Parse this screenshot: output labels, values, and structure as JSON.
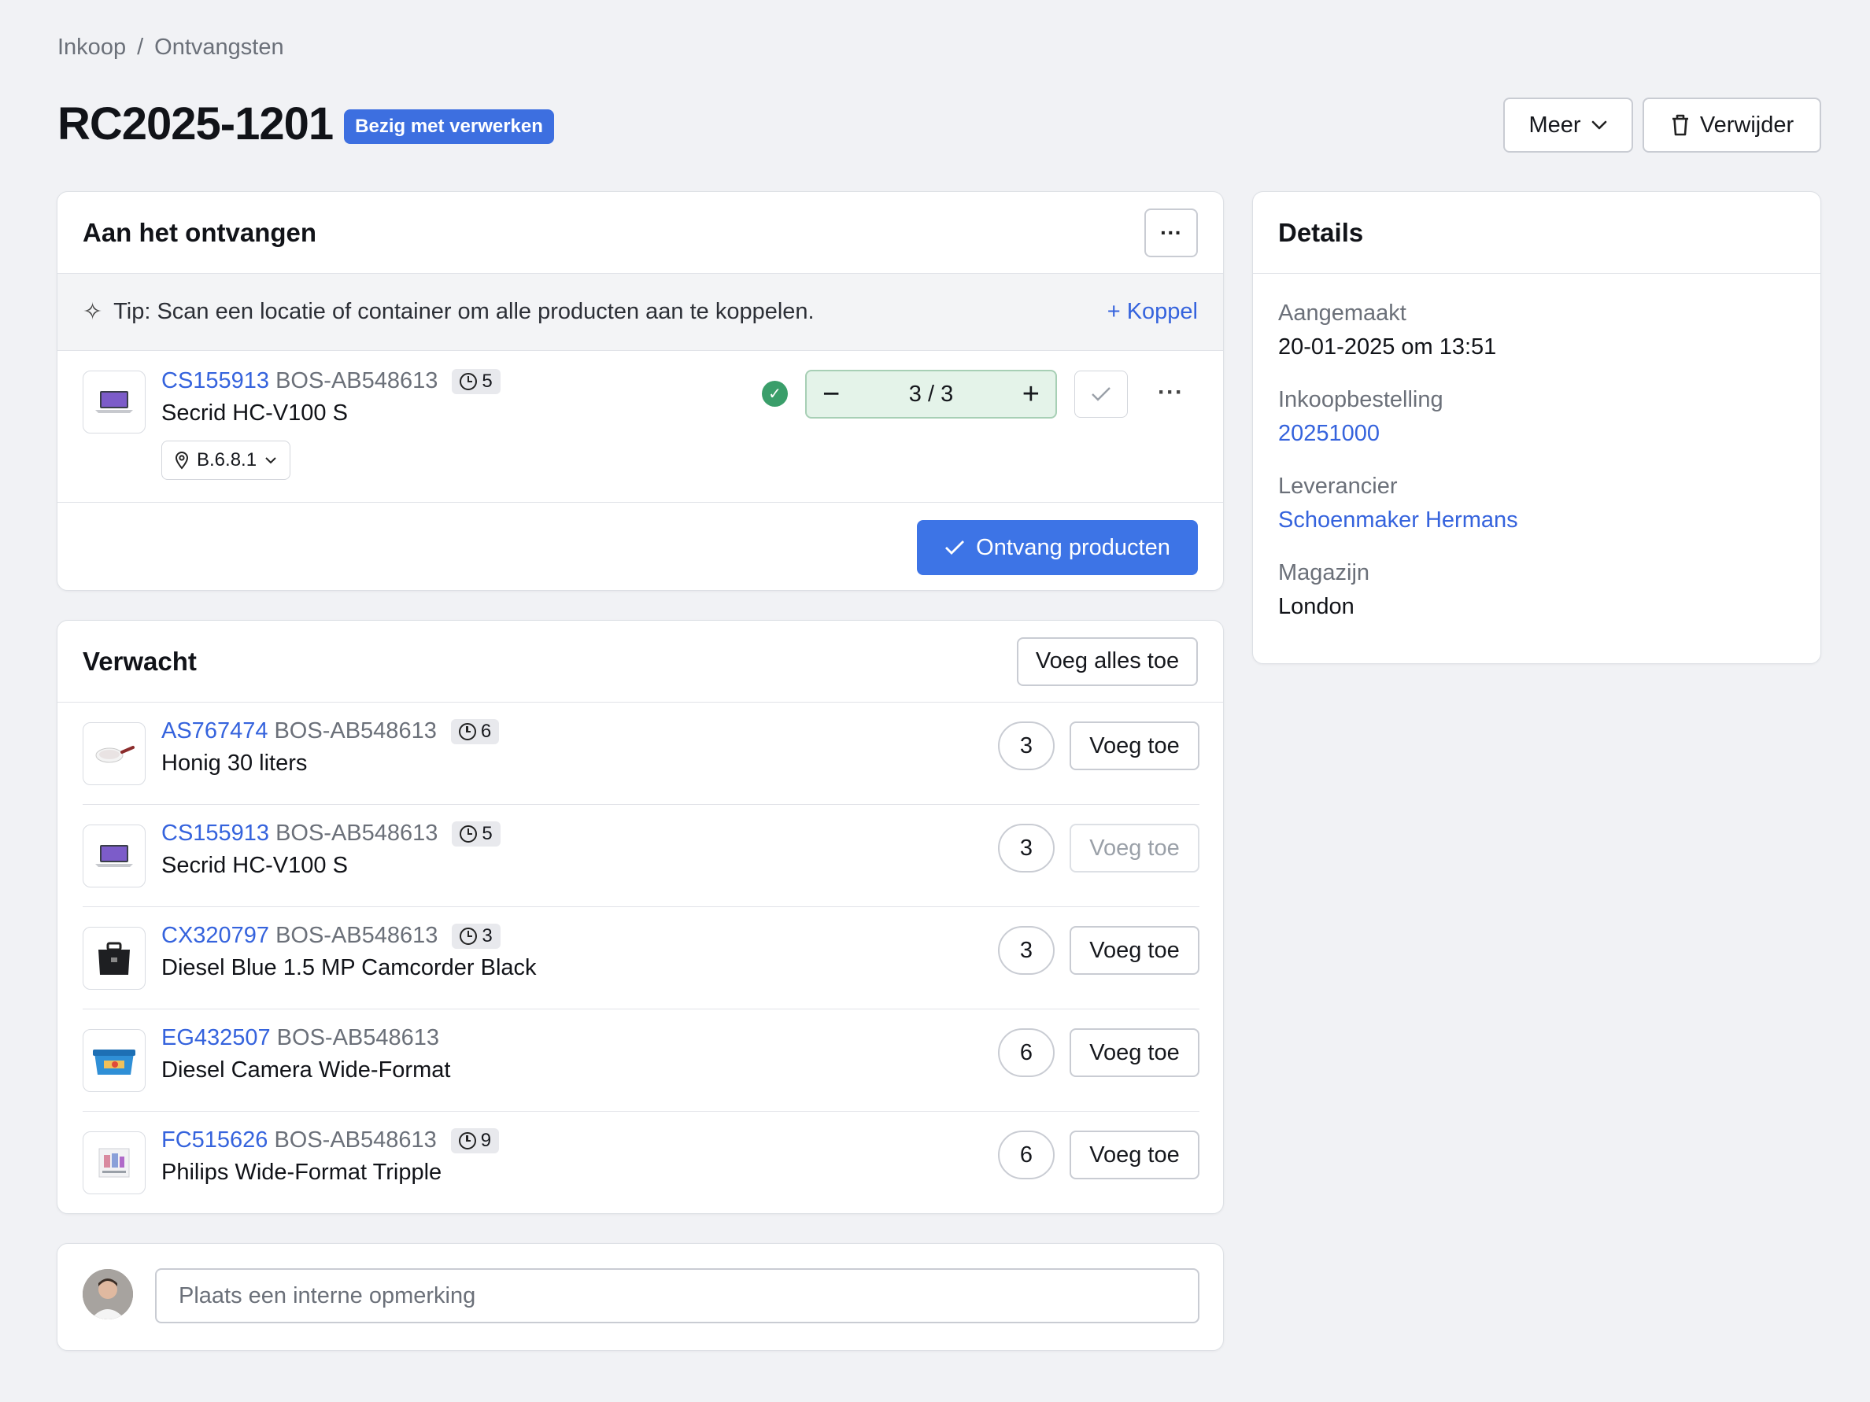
{
  "breadcrumb": {
    "parent": "Inkoop",
    "separator": "/",
    "current": "Ontvangsten"
  },
  "header": {
    "title": "RC2025-1201",
    "status": "Bezig met verwerken",
    "more_label": "Meer",
    "delete_label": "Verwijder"
  },
  "receiving": {
    "title": "Aan het ontvangen",
    "tip": "Tip: Scan een locatie of container om alle producten aan te koppelen.",
    "link_label": "+ Koppel",
    "item": {
      "sku": "CS155913",
      "ref": "BOS-AB548613",
      "badge": "5",
      "name": "Secrid HC-V100 S",
      "location": "B.6.8.1",
      "quantity": "3 / 3"
    },
    "submit_label": "Ontvang producten"
  },
  "expected": {
    "title": "Verwacht",
    "add_all_label": "Voeg alles toe",
    "add_label": "Voeg toe",
    "items": [
      {
        "sku": "AS767474",
        "ref": "BOS-AB548613",
        "badge": "6",
        "name": "Honig 30 liters",
        "qty": "3"
      },
      {
        "sku": "CS155913",
        "ref": "BOS-AB548613",
        "badge": "5",
        "name": "Secrid HC-V100 S",
        "qty": "3"
      },
      {
        "sku": "CX320797",
        "ref": "BOS-AB548613",
        "badge": "3",
        "name": "Diesel Blue 1.5 MP Camcorder Black",
        "qty": "3"
      },
      {
        "sku": "EG432507",
        "ref": "BOS-AB548613",
        "badge": "",
        "name": "Diesel Camera Wide-Format",
        "qty": "6"
      },
      {
        "sku": "FC515626",
        "ref": "BOS-AB548613",
        "badge": "9",
        "name": "Philips Wide-Format Tripple",
        "qty": "6"
      }
    ]
  },
  "comment": {
    "placeholder": "Plaats een interne opmerking"
  },
  "details": {
    "title": "Details",
    "created_label": "Aangemaakt",
    "created_value": "20-01-2025 om 13:51",
    "po_label": "Inkoopbestelling",
    "po_value": "20251000",
    "supplier_label": "Leverancier",
    "supplier_value": "Schoenmaker Hermans",
    "warehouse_label": "Magazijn",
    "warehouse_value": "London"
  },
  "colors": {
    "accent": "#3d74e6",
    "link": "#3563dd",
    "success": "#3a9e6a",
    "background": "#f1f2f5"
  }
}
